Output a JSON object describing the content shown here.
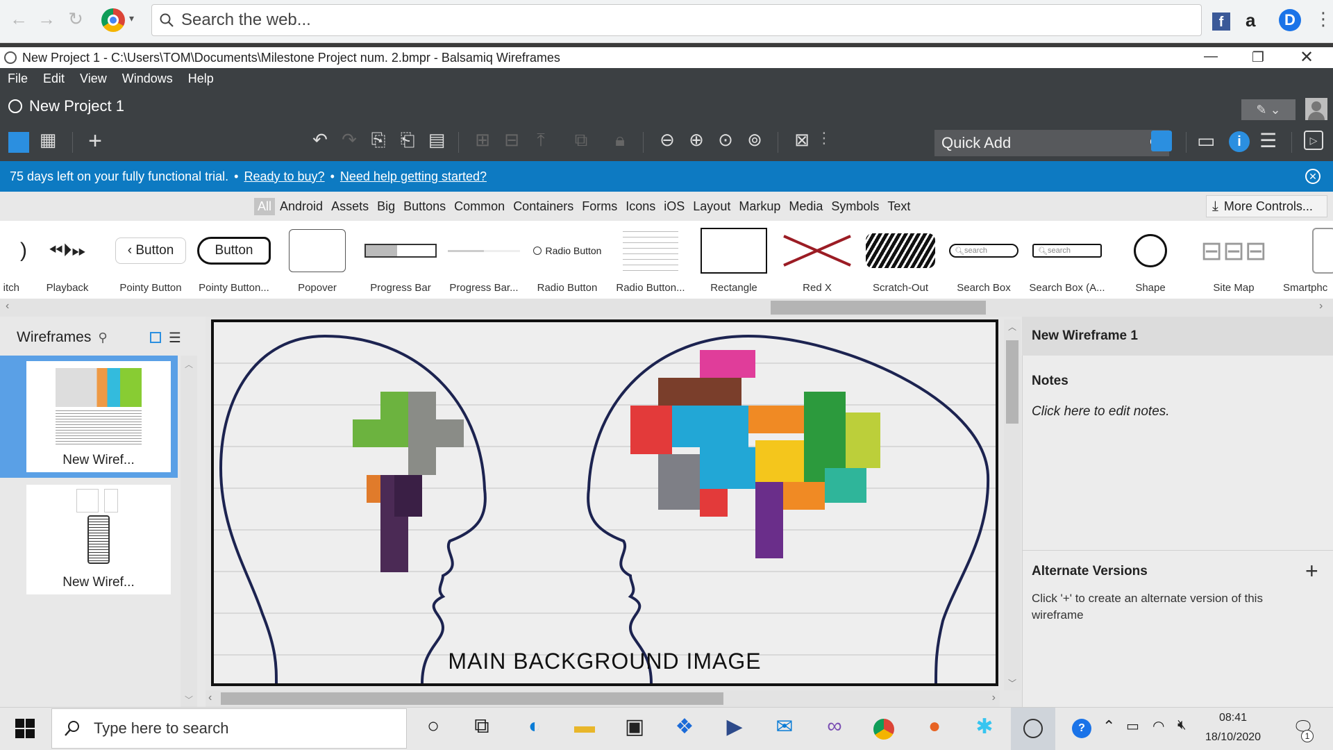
{
  "browser": {
    "search_placeholder": "Search the web...",
    "icons": [
      "back-arrow-icon",
      "forward-arrow-icon",
      "reload-icon",
      "chrome-icon",
      "facebook-icon",
      "amazon-icon",
      "d-extension-icon",
      "menu-icon"
    ],
    "ext_facebook": "f",
    "ext_amazon": "a",
    "ext_d": "D"
  },
  "window": {
    "title": "New Project 1 - C:\\Users\\TOM\\Documents\\Milestone Project num. 2.bmpr - Balsamiq Wireframes"
  },
  "menu": [
    "File",
    "Edit",
    "View",
    "Windows",
    "Help"
  ],
  "project": {
    "title": "New Project 1"
  },
  "quick_add": {
    "placeholder": "Quick Add"
  },
  "trial": {
    "message": "75 days left on your fully functional trial.",
    "bullet": "•",
    "buy_link": "Ready to buy?",
    "help_link": "Need help getting started?"
  },
  "filters": {
    "categories": [
      "All",
      "Android",
      "Assets",
      "Big",
      "Buttons",
      "Common",
      "Containers",
      "Forms",
      "Icons",
      "iOS",
      "Layout",
      "Markup",
      "Media",
      "Symbols",
      "Text"
    ],
    "more_controls": "More Controls..."
  },
  "library": [
    {
      "label": "itch"
    },
    {
      "label": "Playback"
    },
    {
      "label": "Pointy Button",
      "text": "Button"
    },
    {
      "label": "Pointy Button...",
      "text": "Button"
    },
    {
      "label": "Popover"
    },
    {
      "label": "Progress Bar"
    },
    {
      "label": "Progress Bar..."
    },
    {
      "label": "Radio Button",
      "text": "Radio Button"
    },
    {
      "label": "Radio Button..."
    },
    {
      "label": "Rectangle"
    },
    {
      "label": "Red X"
    },
    {
      "label": "Scratch-Out"
    },
    {
      "label": "Search Box",
      "text": "search"
    },
    {
      "label": "Search Box (A...",
      "text": "search"
    },
    {
      "label": "Shape"
    },
    {
      "label": "Site Map"
    },
    {
      "label": "Smartphc"
    }
  ],
  "wireframes_panel": {
    "title": "Wireframes",
    "items": [
      {
        "label": "New Wiref...",
        "selected": true
      },
      {
        "label": "New Wiref...",
        "selected": false
      }
    ]
  },
  "canvas": {
    "caption": "MAIN BACKGROUND IMAGE"
  },
  "inspector": {
    "wireframe_name": "New Wireframe 1",
    "notes_title": "Notes",
    "notes_placeholder": "Click here to edit notes.",
    "alt_title": "Alternate Versions",
    "alt_hint": "Click '+' to create an alternate version of this wireframe"
  },
  "taskbar": {
    "search_placeholder": "Type here to search",
    "time": "08:41",
    "date": "18/10/2020",
    "notification_count": "1"
  },
  "colors": {
    "app_dark": "#3c4043",
    "trial_blue": "#0d7ac2",
    "selected_blue": "#5aa0e6",
    "red_x": "#9b1c24"
  }
}
